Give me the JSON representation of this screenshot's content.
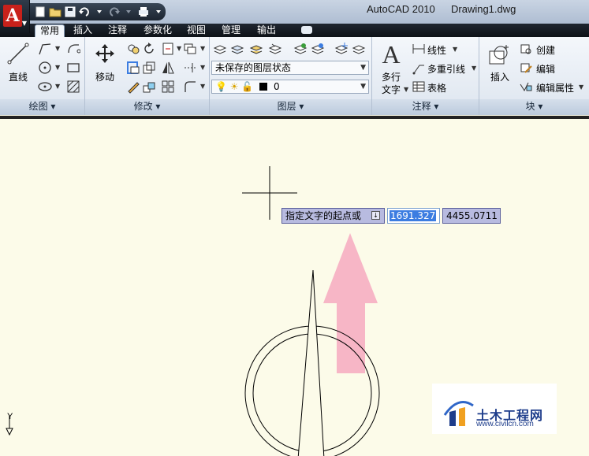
{
  "app": {
    "title": "AutoCAD 2010",
    "document": "Drawing1.dwg",
    "logo_letter": "A"
  },
  "tabs": [
    {
      "label": "常用",
      "active": true
    },
    {
      "label": "插入"
    },
    {
      "label": "注释"
    },
    {
      "label": "参数化"
    },
    {
      "label": "视图"
    },
    {
      "label": "管理"
    },
    {
      "label": "输出"
    }
  ],
  "ribbon": {
    "draw": {
      "line_label": "直线",
      "footer": "绘图 ▾"
    },
    "modify": {
      "move_label": "移动",
      "footer": "修改 ▾"
    },
    "layers": {
      "state_value": "未保存的图层状态",
      "layer_value": "0",
      "footer": "图层 ▾"
    },
    "annotation": {
      "mtext_label1": "多行",
      "mtext_label2": "文字",
      "linear_label": "线性",
      "multileader_label": "多重引线",
      "table_label": "表格",
      "footer": "注释 ▾"
    },
    "block": {
      "insert_label": "插入",
      "create_label": "创建",
      "edit_label": "编辑",
      "edit_attr_label": "编辑属性",
      "footer": "块 ▾"
    }
  },
  "canvas": {
    "prompt_text": "指定文字的起点或",
    "coord_x": "1691.327",
    "coord_y": "4455.0711",
    "ucs_label": "Y"
  },
  "watermark": {
    "name": "土木工程网",
    "url": "www.civilcn.com"
  },
  "colors": {
    "canvas_bg": "#fcfbe9",
    "arrow_pink": "#f7b6c6",
    "prompt_bg": "#b8bbe0",
    "highlight": "#3c7de1"
  }
}
